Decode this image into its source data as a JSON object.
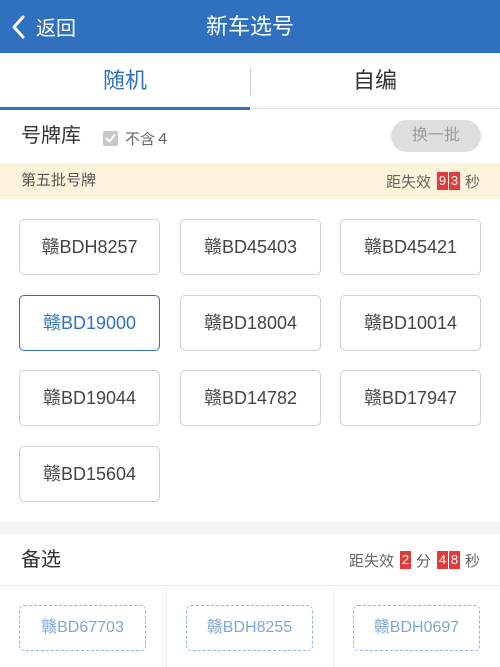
{
  "header": {
    "back_label": "返回",
    "title": "新车选号"
  },
  "tabs": [
    {
      "label": "随机",
      "active": true
    },
    {
      "label": "自编",
      "active": false
    }
  ],
  "library": {
    "title": "号牌库",
    "exclude_label": "不含４",
    "exclude_checked": true,
    "change_button": "换一批"
  },
  "batch": {
    "label": "第五批号牌",
    "countdown_prefix": "距失效",
    "digits": [
      "9",
      "3"
    ],
    "unit": "秒"
  },
  "plates": [
    {
      "text": "赣BDH8257",
      "selected": false
    },
    {
      "text": "赣BD45403",
      "selected": false
    },
    {
      "text": "赣BD45421",
      "selected": false
    },
    {
      "text": "赣BD19000",
      "selected": true
    },
    {
      "text": "赣BD18004",
      "selected": false
    },
    {
      "text": "赣BD10014",
      "selected": false
    },
    {
      "text": "赣BD19044",
      "selected": false
    },
    {
      "text": "赣BD14782",
      "selected": false
    },
    {
      "text": "赣BD17947",
      "selected": false
    },
    {
      "text": "赣BD15604",
      "selected": false
    }
  ],
  "alternates": {
    "title": "备选",
    "countdown_prefix": "距失效",
    "min_digit": "2",
    "min_unit": "分",
    "sec_digits": [
      "4",
      "8"
    ],
    "sec_unit": "秒",
    "items": [
      "赣BD67703",
      "赣BDH8255",
      "赣BDH0697"
    ]
  },
  "colors": {
    "primary": "#2f71be",
    "countdown_red": "#e23b3b",
    "batch_bg": "#fdf2da"
  }
}
